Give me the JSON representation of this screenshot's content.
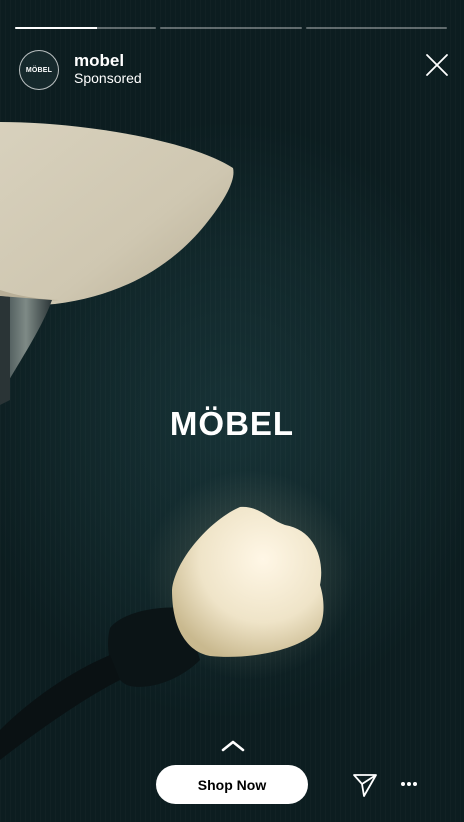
{
  "story": {
    "progress": [
      0.58,
      0,
      0
    ],
    "account": {
      "name": "mobel",
      "sponsored": "Sponsored",
      "avatar_text": "MÖBEL"
    },
    "brand_text": "MÖBEL",
    "cta_label": "Shop Now",
    "icons": {
      "close": "close-icon",
      "swipe_up": "chevron-up-icon",
      "share": "paper-plane-icon",
      "more": "more-dots-icon"
    },
    "colors": {
      "background": "#11272a",
      "button": "#ffffff",
      "text": "#ffffff"
    }
  }
}
